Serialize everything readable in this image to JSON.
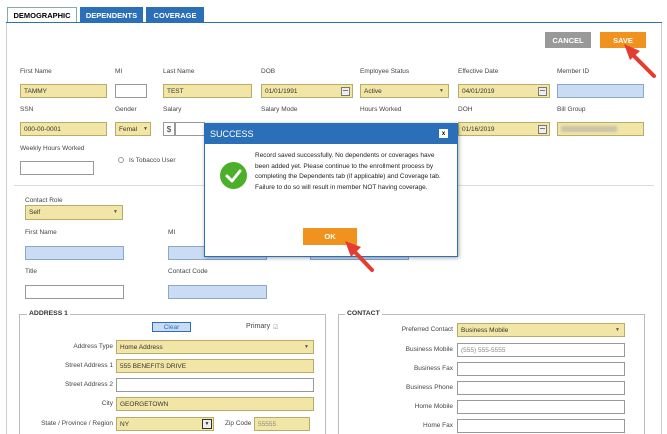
{
  "tabs": [
    {
      "label": "DEMOGRAPHIC"
    },
    {
      "label": "DEPENDENTS"
    },
    {
      "label": "COVERAGE"
    }
  ],
  "actions": {
    "cancel": "CANCEL",
    "save": "SAVE"
  },
  "fields": {
    "first_name": {
      "label": "First Name",
      "value": "TAMMY"
    },
    "mi": {
      "label": "MI",
      "value": ""
    },
    "last_name": {
      "label": "Last Name",
      "value": "TEST"
    },
    "dob": {
      "label": "DOB",
      "value": "01/01/1991"
    },
    "employee_status": {
      "label": "Employee Status",
      "value": "Active"
    },
    "effective_date": {
      "label": "Effective Date",
      "value": "04/01/2019"
    },
    "member_id": {
      "label": "Member ID",
      "value": ""
    },
    "ssn": {
      "label": "SSN",
      "value": "000-00-0001"
    },
    "gender": {
      "label": "Gender",
      "value": "Femal"
    },
    "salary": {
      "label": "Salary",
      "value": ""
    },
    "salary_prefix": "$",
    "salary_mode": {
      "label": "Salary Mode"
    },
    "hours_worked": {
      "label": "Hours Worked"
    },
    "doh": {
      "label": "DOH",
      "value": "01/16/2019"
    },
    "bill_group": {
      "label": "Bill Group",
      "value": ""
    },
    "weekly_hours": {
      "label": "Weekly Hours Worked",
      "value": ""
    },
    "tobacco": {
      "label": "Is Tobacco User"
    }
  },
  "contact_section": {
    "role": {
      "label": "Contact Role",
      "value": "Self"
    },
    "first_name": {
      "label": "First Name",
      "value": ""
    },
    "mi": {
      "label": "MI",
      "value": ""
    },
    "title": {
      "label": "Title",
      "value": ""
    },
    "contact_code": {
      "label": "Contact Code",
      "value": ""
    }
  },
  "address": {
    "legend": "ADDRESS 1",
    "clear": "Clear",
    "primary": "Primary",
    "address_type": {
      "label": "Address Type",
      "value": "Home Address"
    },
    "street1": {
      "label": "Street Address 1",
      "value": "555 BENEFITS DRIVE"
    },
    "street2": {
      "label": "Street Address 2",
      "value": ""
    },
    "city": {
      "label": "City",
      "value": "GEORGETOWN"
    },
    "state": {
      "label": "State / Province / Region",
      "value": "NY"
    },
    "zip": {
      "label": "Zip Code",
      "value": "55555"
    }
  },
  "contact": {
    "legend": "CONTACT",
    "preferred": {
      "label": "Preferred Contact",
      "value": "Business Mobile"
    },
    "business_mobile": {
      "label": "Business Mobile",
      "placeholder": "(555) 555-5555"
    },
    "business_fax": {
      "label": "Business Fax",
      "value": ""
    },
    "business_phone": {
      "label": "Business Phone",
      "value": ""
    },
    "home_mobile": {
      "label": "Home Mobile",
      "value": ""
    },
    "home_fax": {
      "label": "Home Fax",
      "value": ""
    }
  },
  "modal": {
    "title": "SUCCESS",
    "close": "x",
    "message": "Record saved successfully. No dependents or coverages have been added yet. Please continue to the enrollment process by completing the Dependents tab (if applicable) and Coverage tab. Failure to do so will result in member NOT having coverage.",
    "ok": "OK"
  },
  "colors": {
    "accent": "#2a6fb7",
    "save": "#f0931e",
    "cancel": "#999999",
    "required": "#f1e6a6",
    "arrow": "#e23d30"
  }
}
